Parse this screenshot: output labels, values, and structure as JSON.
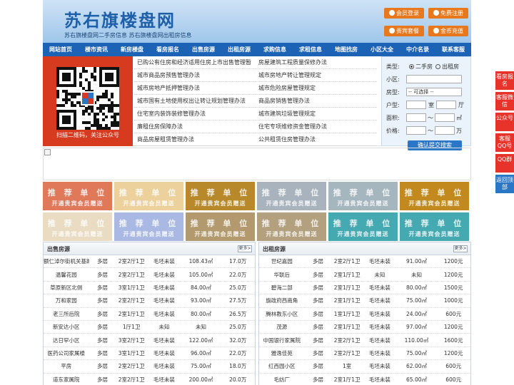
{
  "header": {
    "title": "苏右旗楼盘网",
    "subtitle": "苏右旗楼盘网二手房信息    苏右旗楼盘网出租房信息",
    "buttons": [
      "会员登录",
      "免费注册",
      "贵宾套餐",
      "金币充值"
    ]
  },
  "nav": [
    "网站首页",
    "楼市资讯",
    "新房楼盘",
    "看房报名",
    "出售房源",
    "出租房源",
    "求购信息",
    "求租信息",
    "地图找房",
    "小区大全",
    "中介名录",
    "联系客服"
  ],
  "qr": {
    "caption": "扫描二维码，关注公众号"
  },
  "news": [
    [
      "已购公有住房和经济适用住房上市出售管理暂",
      "房屋建筑工程质量保修办法"
    ],
    [
      "城市商品房预售管理办法",
      "城市房地产转让管理规定"
    ],
    [
      "城市房地产抵押管理办法",
      "城市危险房屋管理规定"
    ],
    [
      "城市国有土地使用权出让转让规划管理办法",
      "商品房销售管理办法"
    ],
    [
      "住宅室内装饰装修管理办法",
      "城市建筑垃圾管理规定"
    ],
    [
      "廉租住房保障办法",
      "住宅专项维修资金管理办法"
    ],
    [
      "商品房屋租赁管理办法",
      "公共租赁住房管理办法"
    ]
  ],
  "search": {
    "type_label": "类型:",
    "type_options": [
      "二手房",
      "出租房"
    ],
    "district_label": "小区:",
    "layout_label": "房型:",
    "layout_select": "-- 可选择 --",
    "rooms_label": "户型:",
    "room_unit": "室",
    "hall_unit": "厅",
    "area_label": "面积:",
    "area_unit": "㎡",
    "price_label": "价格:",
    "price_unit": "万",
    "tilde": "～",
    "submit": "确认提交搜索"
  },
  "ads": {
    "line1": "推 荐 单 位",
    "line2": "开通贵宾会员赠送",
    "colors": [
      "#e0785a",
      "#ecd19c",
      "#b8892b",
      "#a9b3bd",
      "#a6b6bf",
      "#c28a1e",
      "#e9dcc3",
      "#a9b9e3",
      "#b29a6e",
      "#b3a07e",
      "#45a9b2",
      "#45a9b2"
    ]
  },
  "sale": {
    "title": "出售房源",
    "more": "更多>",
    "rows": [
      [
        "额仁淖尔街机关基路",
        "多层",
        "2室2厅1卫",
        "毛坯未装",
        "108.43㎡",
        "17.0万"
      ],
      [
        "温馨花园",
        "多层",
        "2室2厅1卫",
        "毛坯未装",
        "105.00㎡",
        "22.0万"
      ],
      [
        "草原新区北侧",
        "多层",
        "3室1厅1卫",
        "毛坯未装",
        "84.00㎡",
        "25.0万"
      ],
      [
        "万和家园",
        "多层",
        "2室2厅1卫",
        "毛坯未装",
        "93.00㎡",
        "27.5万"
      ],
      [
        "老三所后院",
        "多层",
        "2室1厅1卫",
        "毛坯未装",
        "80.00㎡",
        "26.5万"
      ],
      [
        "新安达小区",
        "多层",
        "1厅1卫",
        "未知",
        "未知",
        "25.0万"
      ],
      [
        "达日罕小区",
        "多层",
        "3室2厅1卫",
        "毛坯未装",
        "122.00㎡",
        "32.0万"
      ],
      [
        "医药公司家属楼",
        "多层",
        "3室1厅1卫",
        "毛坯未装",
        "96.00㎡",
        "22.0万"
      ],
      [
        "平房",
        "多层",
        "2室2厅1卫",
        "毛坯未装",
        "75.00㎡",
        "18.0万"
      ],
      [
        "道东家属院",
        "多层",
        "2室2厅1卫",
        "毛坯未装",
        "200.00㎡",
        "20.0万"
      ]
    ]
  },
  "rent": {
    "title": "出租房源",
    "more": "更多>",
    "rows": [
      [
        "世纪嘉园",
        "多层",
        "2室2厅1卫",
        "毛坯未装",
        "91.00㎡",
        "1200元"
      ],
      [
        "华联后",
        "多层",
        "2室1厅1卫",
        "未知",
        "未知",
        "1200元"
      ],
      [
        "碧海二部",
        "多层",
        "2室1厅1卫",
        "毛坯未装",
        "80.00㎡",
        "1500元"
      ],
      [
        "旗政府西南角",
        "多层",
        "2室1厅1卫",
        "毛坯未装",
        "75.00㎡",
        "1000元"
      ],
      [
        "腾林教东小区",
        "多层",
        "1室1厅1卫",
        "毛坯未装",
        "24.00㎡",
        "600元"
      ],
      [
        "茂源",
        "多层",
        "2室1厅1卫",
        "毛坯未装",
        "97.00㎡",
        "1200元"
      ],
      [
        "中国银行家属院",
        "多层",
        "2室2厅1卫",
        "毛坯未装",
        "110.00㎡",
        "1600元"
      ],
      [
        "雅逸佳苑",
        "多层",
        "2室2厅1卫",
        "毛坯未装",
        "75.00㎡",
        "1200元"
      ],
      [
        "红西园小区",
        "多层",
        "1室",
        "毛坯未装",
        "62.00㎡",
        "600元"
      ],
      [
        "毛纺厂",
        "多层",
        "2室1厅1卫",
        "毛坯未装",
        "65.00㎡",
        "600元"
      ]
    ]
  },
  "side": [
    "看房报名",
    "客服微信",
    "公众号",
    "客服QQ号",
    "QQ群",
    "返回顶部"
  ]
}
